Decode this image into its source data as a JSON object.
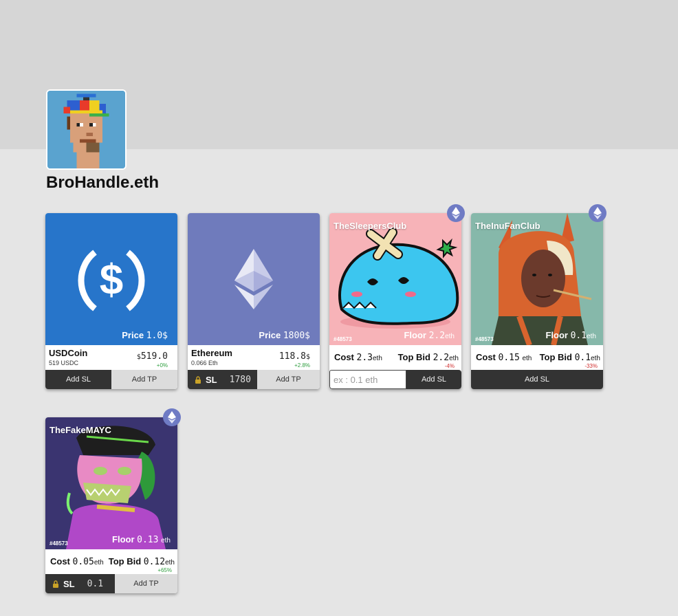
{
  "profile": {
    "username": "BroHandle.eth"
  },
  "cards": [
    {
      "name": "USDCoin",
      "subtext": "519 USDC",
      "price_label": "Price",
      "price_value": "1.0",
      "price_unit": "$",
      "value_unit": "$",
      "value": "519.0",
      "change": "+0%",
      "btn_left": "Add SL",
      "btn_right": "Add TP",
      "bg_color": "#2775ca"
    },
    {
      "name": "Ethereum",
      "subtext": "0.066 Eth",
      "price_label": "Price",
      "price_value": "1800",
      "price_unit": "$",
      "value": "118.8",
      "value_unit": "$",
      "change": "+2.8%",
      "sl_label": "SL",
      "sl_value": "1780",
      "btn_right": "Add TP",
      "bg_color": "#6f7bbc"
    },
    {
      "collection": "TheSleepersClub",
      "token_id": "#48573",
      "floor_label": "Floor",
      "floor_value": "2.2",
      "floor_unit": "eth",
      "cost_label": "Cost",
      "cost_value": "2.3",
      "cost_unit": "eth",
      "bid_label": "Top Bid",
      "bid_value": "2.2",
      "bid_unit": "eth",
      "change": "-4%",
      "input_placeholder": "ex : 0.1 eth",
      "btn_right": "Add SL",
      "bg_color": "#f7b3b8"
    },
    {
      "collection": "TheInuFanClub",
      "token_id": "#48573",
      "floor_label": "Floor",
      "floor_value": "0.1",
      "floor_unit": "eth",
      "cost_label": "Cost",
      "cost_value": "0.15",
      "cost_unit": "eth",
      "bid_label": "Top Bid",
      "bid_value": "0.1",
      "bid_unit": "eth",
      "change": "-33%",
      "btn_full": "Add SL",
      "bg_color": "#86b8aa"
    },
    {
      "collection": "TheFakeMAYC",
      "token_id": "#48573",
      "floor_label": "Floor",
      "floor_value": "0.13",
      "floor_unit": "eth",
      "cost_label": "Cost",
      "cost_value": "0.05",
      "cost_unit": "eth",
      "bid_label": "Top Bid",
      "bid_value": "0.12",
      "bid_unit": "eth",
      "change": "+65%",
      "sl_label": "SL",
      "sl_value": "0.1",
      "btn_right": "Add TP",
      "bg_color": "#3a3470"
    }
  ]
}
